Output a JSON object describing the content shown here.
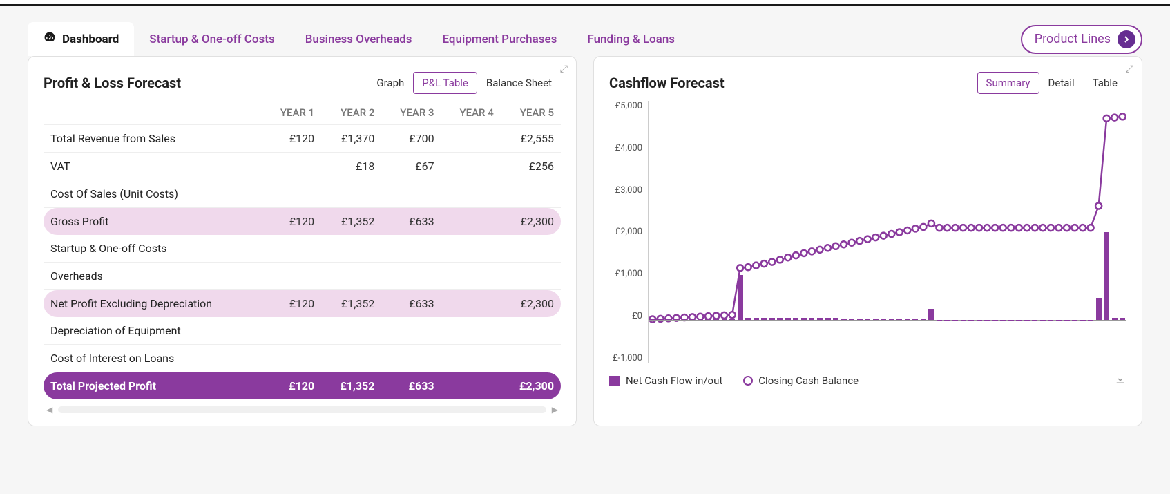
{
  "tabs": {
    "dashboard": "Dashboard",
    "startup": "Startup & One-off Costs",
    "overheads": "Business Overheads",
    "equipment": "Equipment Purchases",
    "funding": "Funding & Loans"
  },
  "product_lines_label": "Product Lines",
  "pl_card": {
    "title": "Profit & Loss Forecast",
    "views": {
      "graph": "Graph",
      "table": "P&L Table",
      "balance": "Balance Sheet"
    },
    "columns": [
      "YEAR 1",
      "YEAR 2",
      "YEAR 3",
      "YEAR 4",
      "YEAR 5"
    ],
    "rows": [
      {
        "label": "Total Revenue from Sales",
        "values": [
          "£120",
          "£1,370",
          "£700",
          "",
          "£2,555"
        ],
        "style": "plain"
      },
      {
        "label": "VAT",
        "values": [
          "",
          "£18",
          "£67",
          "",
          "£256"
        ],
        "style": "plain"
      },
      {
        "label": "Cost Of Sales (Unit Costs)",
        "values": [
          "",
          "",
          "",
          "",
          ""
        ],
        "style": "plain"
      },
      {
        "label": "Gross Profit",
        "values": [
          "£120",
          "£1,352",
          "£633",
          "",
          "£2,300"
        ],
        "style": "light"
      },
      {
        "label": "Startup & One-off Costs",
        "values": [
          "",
          "",
          "",
          "",
          ""
        ],
        "style": "plain"
      },
      {
        "label": "Overheads",
        "values": [
          "",
          "",
          "",
          "",
          ""
        ],
        "style": "plain"
      },
      {
        "label": "Net Profit Excluding Depreciation",
        "values": [
          "£120",
          "£1,352",
          "£633",
          "",
          "£2,300"
        ],
        "style": "light"
      },
      {
        "label": "Depreciation of Equipment",
        "values": [
          "",
          "",
          "",
          "",
          ""
        ],
        "style": "plain"
      },
      {
        "label": "Cost of Interest on Loans",
        "values": [
          "",
          "",
          "",
          "",
          ""
        ],
        "style": "plain"
      },
      {
        "label": "Total Projected Profit",
        "values": [
          "£120",
          "£1,352",
          "£633",
          "",
          "£2,300"
        ],
        "style": "dark"
      }
    ]
  },
  "cf_card": {
    "title": "Cashflow Forecast",
    "views": {
      "summary": "Summary",
      "detail": "Detail",
      "table": "Table"
    },
    "legend": {
      "net": "Net Cash Flow in/out",
      "closing": "Closing Cash Balance"
    }
  },
  "chart_data": {
    "type": "combo",
    "ylabel": "£",
    "ylim": [
      -1000,
      5000
    ],
    "y_ticks": [
      "£5,000",
      "£4,000",
      "£3,000",
      "£2,000",
      "£1,000",
      "£0",
      "£-1,000"
    ],
    "x": [
      1,
      2,
      3,
      4,
      5,
      6,
      7,
      8,
      9,
      10,
      11,
      12,
      13,
      14,
      15,
      16,
      17,
      18,
      19,
      20,
      21,
      22,
      23,
      24,
      25,
      26,
      27,
      28,
      29,
      30,
      31,
      32,
      33,
      34,
      35,
      36,
      37,
      38,
      39,
      40,
      41,
      42,
      43,
      44,
      45,
      46,
      47,
      48,
      49,
      50,
      51,
      52,
      53,
      54,
      55,
      56,
      57,
      58,
      59,
      60
    ],
    "series": [
      {
        "name": "Net Cash Flow in/out",
        "kind": "bar",
        "color": "#8a3a9e",
        "values": [
          10,
          10,
          10,
          10,
          10,
          10,
          10,
          10,
          10,
          10,
          10,
          1020,
          40,
          40,
          40,
          40,
          40,
          40,
          40,
          40,
          40,
          40,
          40,
          40,
          30,
          30,
          30,
          30,
          30,
          30,
          30,
          30,
          30,
          30,
          30,
          250,
          0,
          0,
          0,
          0,
          0,
          0,
          0,
          0,
          0,
          0,
          0,
          0,
          0,
          0,
          0,
          0,
          0,
          0,
          0,
          0,
          500,
          2000,
          50,
          50
        ]
      },
      {
        "name": "Closing Cash Balance",
        "kind": "line",
        "color": "#8a3a9e",
        "values": [
          10,
          20,
          30,
          40,
          50,
          60,
          70,
          80,
          90,
          100,
          110,
          1180,
          1200,
          1240,
          1280,
          1320,
          1370,
          1420,
          1470,
          1520,
          1560,
          1600,
          1640,
          1680,
          1720,
          1760,
          1800,
          1840,
          1880,
          1920,
          1960,
          2000,
          2040,
          2080,
          2120,
          2200,
          2100,
          2100,
          2100,
          2100,
          2100,
          2100,
          2100,
          2100,
          2100,
          2100,
          2100,
          2100,
          2100,
          2100,
          2100,
          2100,
          2100,
          2100,
          2100,
          2100,
          2600,
          4600,
          4620,
          4640
        ]
      }
    ]
  },
  "colors": {
    "brand": "#8a3a9e",
    "brand_dark": "#662d91"
  }
}
